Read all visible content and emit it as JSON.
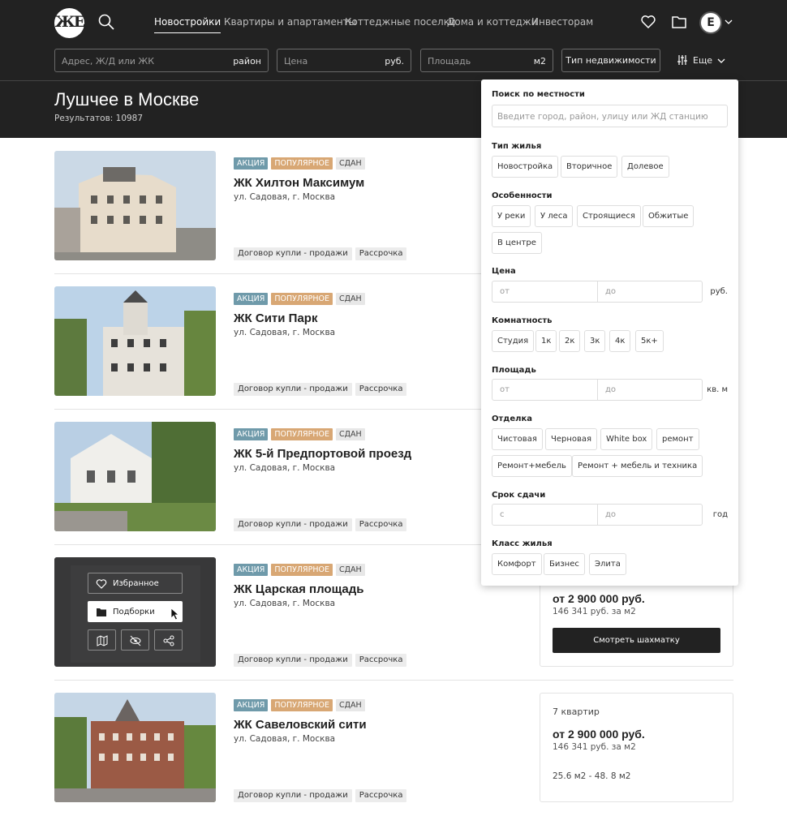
{
  "nav": {
    "logo_text": "ЖЕ",
    "items": [
      "Новостройки",
      "Квартиры и апартаменты",
      "Коттеджные поселки",
      "Дома и коттеджи",
      "Инвесторам"
    ],
    "avatar_letter": "E"
  },
  "filters": {
    "address_placeholder": "Адрес, Ж/Д или ЖК",
    "address_suffix": "район",
    "price_placeholder": "Цена",
    "price_suffix": "руб.",
    "area_placeholder": "Площадь",
    "area_suffix": "м2",
    "type_button": "Тип недвижимости",
    "more_label": "Еще"
  },
  "header": {
    "title": "Лушчее в Москве",
    "results": "Результатов: 10987"
  },
  "listings": [
    {
      "tags": [
        "АКЦИЯ",
        "ПОПУЛЯРНОЕ",
        "СДАН"
      ],
      "name": "ЖК Хилтон Максимум",
      "address": "ул. Садовая, г. Москва",
      "bottom_tags": [
        "Договор купли - продажи",
        "Рассрочка"
      ]
    },
    {
      "tags": [
        "АКЦИЯ",
        "ПОПУЛЯРНОЕ",
        "СДАН"
      ],
      "name": "ЖК Сити Парк",
      "address": "ул. Садовая, г. Москва",
      "bottom_tags": [
        "Договор купли - продажи",
        "Рассрочка"
      ]
    },
    {
      "tags": [
        "АКЦИЯ",
        "ПОПУЛЯРНОЕ",
        "СДАН"
      ],
      "name": "ЖК 5-й Предпортовой проезд",
      "address": "ул. Садовая, г. Москва",
      "bottom_tags": [
        "Договор купли - продажи",
        "Рассрочка"
      ]
    },
    {
      "tags": [
        "АКЦИЯ",
        "ПОПУЛЯРНОЕ",
        "СДАН"
      ],
      "name": "ЖК Царская площадь",
      "address": "ул. Садовая, г. Москва",
      "bottom_tags": [
        "Договор купли - продажи",
        "Рассрочка"
      ]
    },
    {
      "tags": [
        "АКЦИЯ",
        "ПОПУЛЯРНОЕ",
        "СДАН"
      ],
      "name": "ЖК Савеловский сити",
      "address": "ул. Садовая, г. Москва",
      "bottom_tags": [
        "Договор купли - продажи",
        "Рассрочка"
      ]
    }
  ],
  "price_cards": [
    {
      "price": "от 2 900 000 руб.",
      "per_m2": "146 341 руб. за м2",
      "button": "Смотреть шахматку"
    },
    {
      "quarter": "7 квартир",
      "price": "от 2 900 000 руб.",
      "per_m2": "146 341 руб. за м2",
      "area": "25.6 м2 - 48. 8 м2"
    }
  ],
  "hover_menu": {
    "favorites": "Избранное",
    "collections": "Подборки"
  },
  "filter_panel": {
    "location_title": "Поиск по местности",
    "location_placeholder": "Введите город, район, улицу или ЖД станцию",
    "housing_type_title": "Тип жилья",
    "housing_types": [
      "Новостройка",
      "Вторичное",
      "Долевое"
    ],
    "features_title": "Особенности",
    "features": [
      "У реки",
      "У леса",
      "Строящиеся",
      "Обжитые",
      "В центре"
    ],
    "price_title": "Цена",
    "price_from": "от",
    "price_to": "до",
    "price_unit": "руб.",
    "rooms_title": "Комнатность",
    "rooms": [
      "Студия",
      "1к",
      "2к",
      "3к",
      "4к",
      "5к+"
    ],
    "area_title": "Площадь",
    "area_from": "от",
    "area_to": "до",
    "area_unit": "кв. м",
    "finish_title": "Отделка",
    "finishes": [
      "Чистовая",
      "Черновая",
      "White box",
      "ремонт",
      "Ремонт+мебель",
      "Ремонт + мебель и техника"
    ],
    "deadline_title": "Срок сдачи",
    "deadline_from": "с",
    "deadline_to": "до",
    "deadline_unit": "год",
    "class_title": "Класс жилья",
    "classes": [
      "Комфорт",
      "Бизнес",
      "Элита"
    ]
  },
  "colors": {
    "header_bg": "#222222",
    "tag_promo": "#6f9aaa",
    "tag_popular": "#d8a774",
    "tag_done": "#e7e7e7"
  }
}
